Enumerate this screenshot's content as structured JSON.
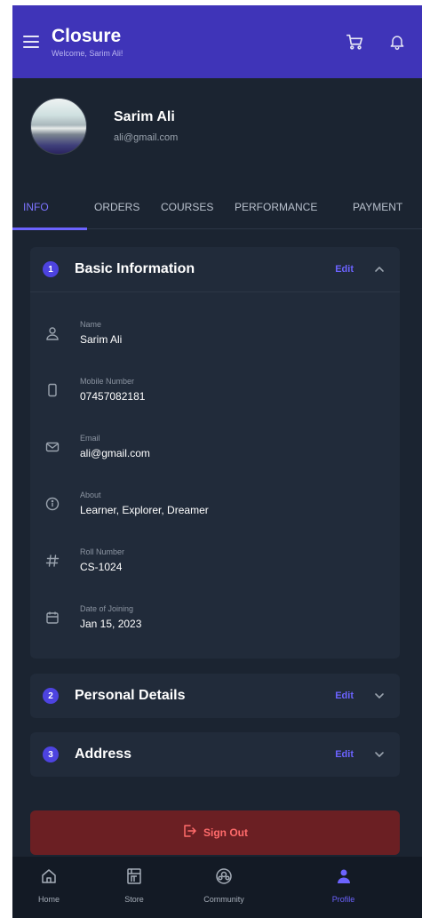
{
  "header": {
    "title": "Closure",
    "subtitle": "Welcome, Sarim Ali!"
  },
  "profile": {
    "name": "Sarim Ali",
    "email": "ali@gmail.com"
  },
  "tabs": [
    {
      "label": "INFO",
      "active": true
    },
    {
      "label": "ORDERS",
      "active": false
    },
    {
      "label": "COURSES",
      "active": false
    },
    {
      "label": "PERFORMANCE",
      "active": false
    },
    {
      "label": "PAYMENT",
      "active": false
    }
  ],
  "sections": [
    {
      "number": "1",
      "title": "Basic Information",
      "edit_label": "Edit",
      "expanded": true,
      "fields": [
        {
          "icon": "user-icon",
          "label": "Name",
          "value": "Sarim Ali"
        },
        {
          "icon": "phone-icon",
          "label": "Mobile Number",
          "value": "07457082181"
        },
        {
          "icon": "mail-icon",
          "label": "Email",
          "value": "ali@gmail.com"
        },
        {
          "icon": "info-icon",
          "label": "About",
          "value": "Learner, Explorer, Dreamer"
        },
        {
          "icon": "hash-icon",
          "label": "Roll Number",
          "value": "CS-1024"
        },
        {
          "icon": "calendar-icon",
          "label": "Date of Joining",
          "value": "Jan 15, 2023"
        }
      ]
    },
    {
      "number": "2",
      "title": "Personal Details",
      "edit_label": "Edit",
      "expanded": false
    },
    {
      "number": "3",
      "title": "Address",
      "edit_label": "Edit",
      "expanded": false
    }
  ],
  "signout": {
    "label": "Sign Out"
  },
  "bottom_nav": [
    {
      "label": "Home",
      "icon": "home-icon",
      "active": false
    },
    {
      "label": "Store",
      "icon": "store-icon",
      "active": false
    },
    {
      "label": "Community",
      "icon": "community-icon",
      "active": false
    },
    {
      "label": "Profile",
      "icon": "profile-icon",
      "active": true
    }
  ],
  "colors": {
    "header_bg": "#3f34b8",
    "accent": "#6c63ff",
    "background": "#1b2431",
    "card": "#212b3a",
    "signout_bg": "#6b1f23",
    "signout_text": "#ff6b6b"
  }
}
